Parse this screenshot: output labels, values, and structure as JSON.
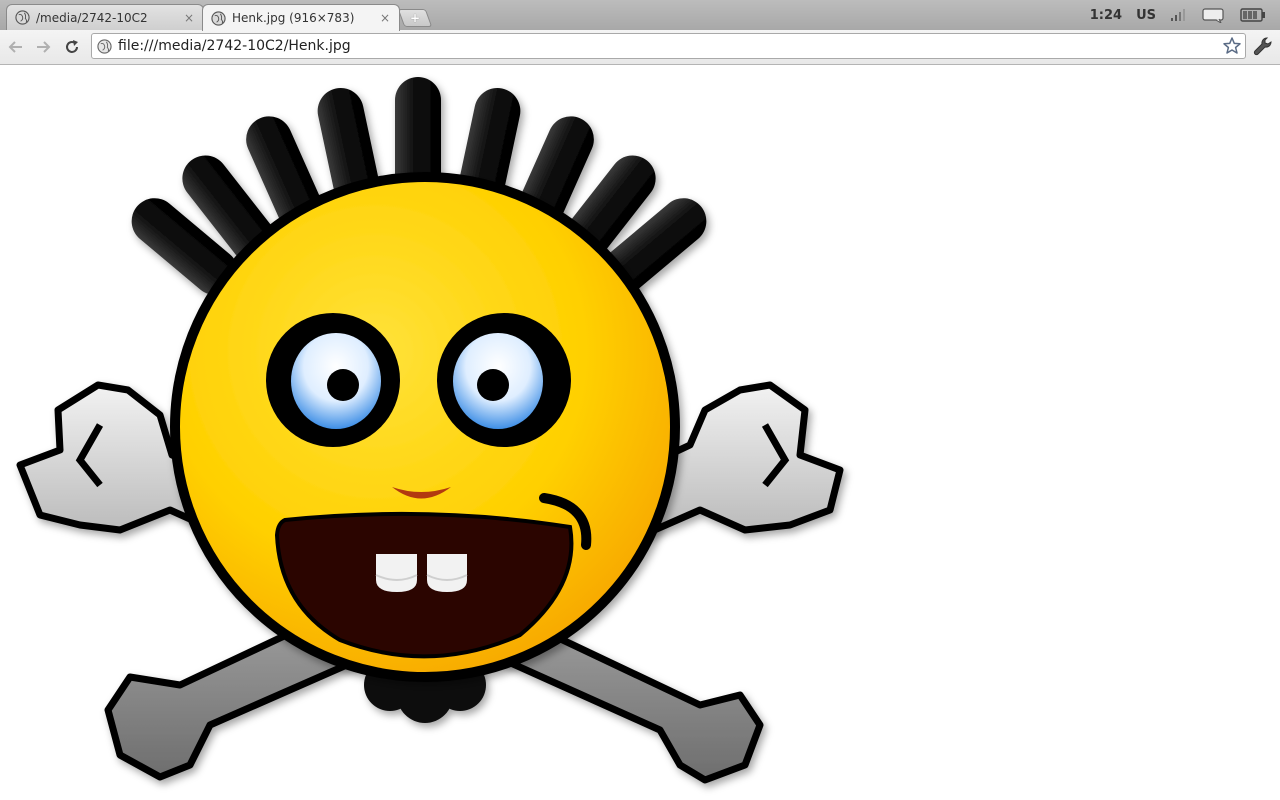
{
  "browser": {
    "tabs": [
      {
        "title": "/media/2742-10C2",
        "active": false,
        "close": "×"
      },
      {
        "title": "Henk.jpg (916×783)",
        "active": true,
        "close": "×"
      }
    ],
    "new_tab_label": "+",
    "url": "file:///media/2742-10C2/Henk.jpg"
  },
  "status_area": {
    "time": "1:24",
    "keyboard_layout": "US",
    "icons": [
      "signal-icon",
      "message-icon",
      "battery-icon"
    ]
  },
  "toolbar": {
    "icons": [
      "back-arrow-icon",
      "forward-arrow-icon",
      "reload-icon",
      "page-icon",
      "bookmark-star-icon",
      "wrench-icon"
    ]
  },
  "image": {
    "name": "Henk.jpg",
    "subject": "smiley-with-wrenches"
  },
  "colors": {
    "face_yellow": "#ffd000",
    "face_orange": "#f9a800",
    "outline": "#000000",
    "wrench_gray": "#a9a9a9",
    "mouth": "#2b0500",
    "iris_blue": "#4f9be8",
    "nose": "#b23a10"
  }
}
